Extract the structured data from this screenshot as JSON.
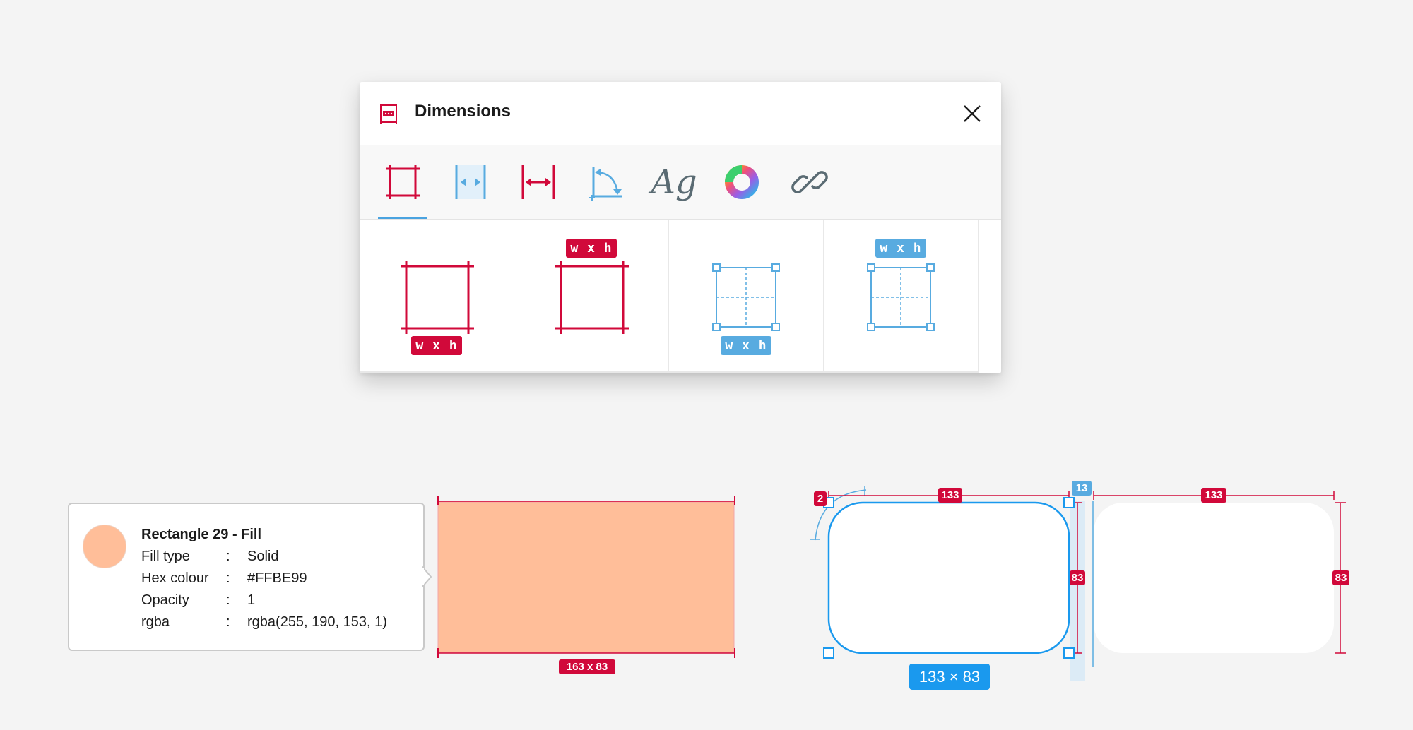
{
  "dialog": {
    "title": "Dimensions",
    "close_label": "close",
    "tabs": [
      {
        "name": "size-tab",
        "icon": "frame-size-icon",
        "active": true
      },
      {
        "name": "spacing-tab",
        "icon": "spacing-icon"
      },
      {
        "name": "distance-tab",
        "icon": "distance-icon"
      },
      {
        "name": "angle-tab",
        "icon": "angle-icon"
      },
      {
        "name": "typography-tab",
        "icon": "typography-icon",
        "label": "Ag"
      },
      {
        "name": "color-tab",
        "icon": "color-wheel-icon"
      },
      {
        "name": "link-tab",
        "icon": "link-icon"
      }
    ],
    "options": [
      {
        "label": "w x h",
        "position": "bottom",
        "color": "#d1093a"
      },
      {
        "label": "w x h",
        "position": "top",
        "color": "#d1093a"
      },
      {
        "label": "w x h",
        "position": "bottom",
        "color": "#58abe0"
      },
      {
        "label": "w x h",
        "position": "top",
        "color": "#58abe0"
      }
    ]
  },
  "fill_info": {
    "title": "Rectangle 29 - Fill",
    "swatch_color": "#FFBE99",
    "rows": [
      {
        "key": "Fill type",
        "value": "Solid"
      },
      {
        "key": "Hex colour",
        "value": "#FFBE99"
      },
      {
        "key": "Opacity",
        "value": "1"
      },
      {
        "key": "rgba",
        "value": "rgba(255, 190, 153, 1)"
      }
    ],
    "colon": ":"
  },
  "orange_rect": {
    "fill": "#FFBE99",
    "size_label": "163 x 83"
  },
  "selection": {
    "width_label": "133",
    "height_label": "83",
    "radius_label": "2",
    "gap_label": "13",
    "size_badge": "133 × 83",
    "accent": "#1a99ee"
  },
  "second_rect": {
    "width_label": "133",
    "height_label": "83"
  },
  "colors": {
    "measure_red": "#d1093a",
    "selection_blue": "#1a99ee",
    "light_blue": "#58abe0"
  }
}
